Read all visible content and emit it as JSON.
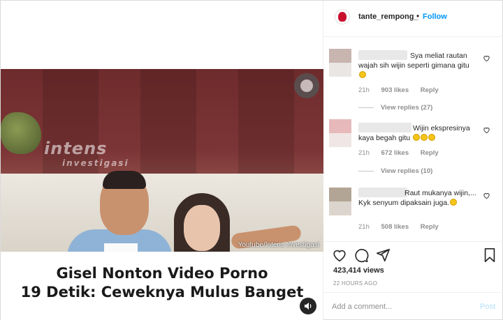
{
  "post": {
    "username": "tante_rempong_",
    "separator": "•",
    "follow_label": "Follow",
    "video_watermark": "intens",
    "video_watermark_sub": "investigasi",
    "video_credit": "Youtube/Intens Investigasi",
    "caption_line1": "Gisel Nonton Video Porno",
    "caption_line2": "19 Detik: Ceweknya Mulus Banget"
  },
  "comments": [
    {
      "text": "Sya meliat rautan wajah sih wijin seperti gimana gitu",
      "emoji": "smiling-face",
      "time": "21h",
      "likes": "903 likes",
      "reply": "Reply",
      "view_replies": "View replies (27)",
      "avatar_colors": [
        "#c9b5b0",
        "#e9e6e4"
      ]
    },
    {
      "text": "Wijin ekspresinya kaya begah gitu",
      "emoji": "grinning-sweat x3",
      "time": "21h",
      "likes": "672 likes",
      "reply": "Reply",
      "view_replies": "View replies (10)",
      "avatar_colors": [
        "#e7b9bb",
        "#f0e6e6"
      ]
    },
    {
      "text": "Raut mukanya wijin,... Kyk senyum dipaksain juga.",
      "emoji": "smiling-face",
      "time": "21h",
      "likes": "508 likes",
      "reply": "Reply",
      "avatar_colors": [
        "#b3a595",
        "#dcd5cd"
      ]
    }
  ],
  "stats": {
    "views": "423,414 views",
    "time_ago": "22 HOURS AGO"
  },
  "composer": {
    "placeholder": "Add a comment...",
    "post_label": "Post"
  },
  "colors": {
    "accent": "#0095f6",
    "muted": "#8e8e8e",
    "post_disabled": "#b2dffc"
  }
}
